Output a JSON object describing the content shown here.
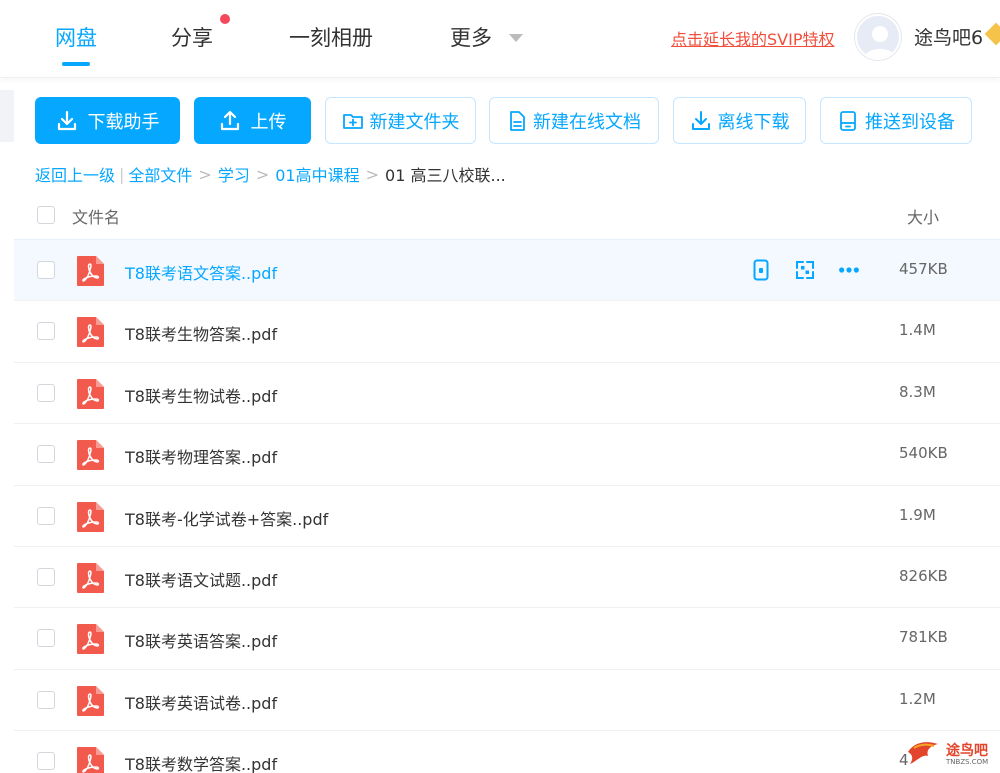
{
  "nav": {
    "items": [
      {
        "label": "网盘",
        "active": true
      },
      {
        "label": "分享",
        "badge_dot": true
      },
      {
        "label": "一刻相册"
      },
      {
        "label": "更多"
      }
    ],
    "svip_link": "点击延长我的SVIP特权",
    "username": "途鸟吧6"
  },
  "toolbar": {
    "download_helper": "下载助手",
    "upload": "上传",
    "new_folder": "新建文件夹",
    "new_online_doc": "新建在线文档",
    "offline_download": "离线下载",
    "push_to_device": "推送到设备"
  },
  "breadcrumb": {
    "back": "返回上一级",
    "all_files": "全部文件",
    "level1": "学习",
    "level2": "01高中课程",
    "current": "01 高三八校联..."
  },
  "table": {
    "col_name": "文件名",
    "col_size": "大小",
    "rows": [
      {
        "name": "T8联考语文答案..pdf",
        "size": "457KB"
      },
      {
        "name": "T8联考生物答案..pdf",
        "size": "1.4M"
      },
      {
        "name": "T8联考生物试卷..pdf",
        "size": "8.3M"
      },
      {
        "name": "T8联考物理答案..pdf",
        "size": "540KB"
      },
      {
        "name": "T8联考-化学试卷+答案..pdf",
        "size": "1.9M"
      },
      {
        "name": "T8联考语文试题..pdf",
        "size": "826KB"
      },
      {
        "name": "T8联考英语答案..pdf",
        "size": "781KB"
      },
      {
        "name": "T8联考英语试卷..pdf",
        "size": "1.2M"
      },
      {
        "name": "T8联考数学答案..pdf",
        "size": "4"
      }
    ]
  },
  "watermark": {
    "text": "途鸟吧",
    "sub": "TNBZS.COM"
  },
  "colors": {
    "accent": "#06a7ff",
    "pdf_red": "#f35a4e",
    "svip_red": "#f24e3c"
  }
}
